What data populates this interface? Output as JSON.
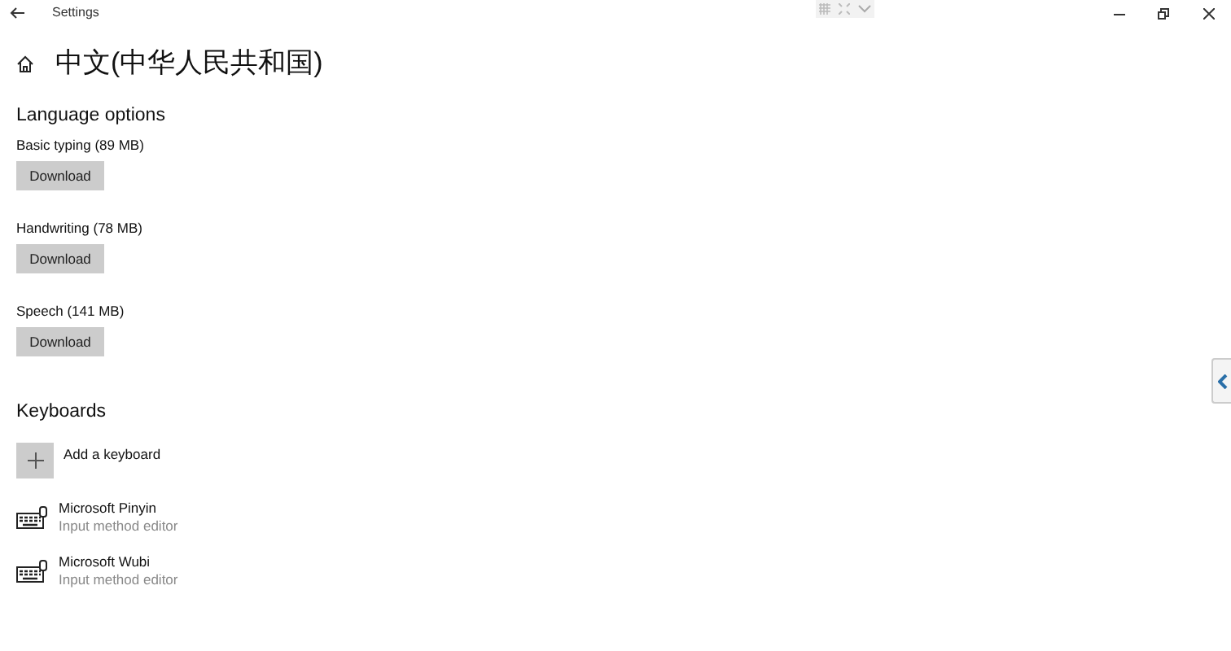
{
  "window": {
    "title": "Settings"
  },
  "heading": "中文(中华人民共和国)",
  "language_options": {
    "title": "Language options",
    "items": [
      {
        "label": "Basic typing (89 MB)",
        "button": "Download"
      },
      {
        "label": "Handwriting (78 MB)",
        "button": "Download"
      },
      {
        "label": "Speech (141 MB)",
        "button": "Download"
      }
    ]
  },
  "keyboards": {
    "title": "Keyboards",
    "add_label": "Add a keyboard",
    "items": [
      {
        "name": "Microsoft Pinyin",
        "description": "Input method editor"
      },
      {
        "name": "Microsoft Wubi",
        "description": "Input method editor"
      }
    ]
  }
}
